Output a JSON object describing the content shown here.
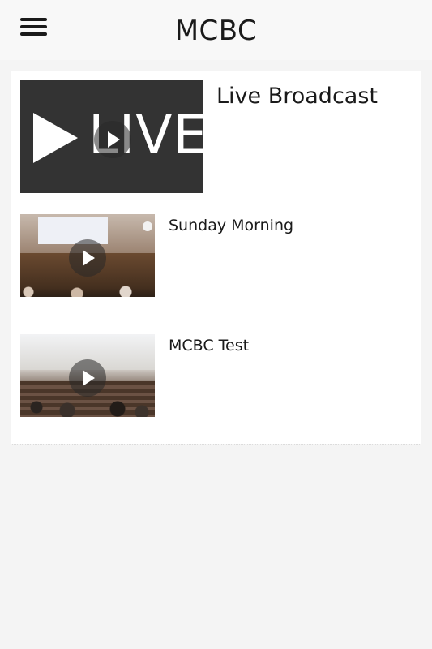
{
  "header": {
    "title": "MCBC",
    "menu_icon": "hamburger-menu-icon"
  },
  "videos": [
    {
      "title": "Live Broadcast",
      "thumbnail_text": "LIVE",
      "thumbnail_style": "live-banner"
    },
    {
      "title": "Sunday Morning",
      "thumbnail_style": "sanctuary-photo"
    },
    {
      "title": "MCBC Test",
      "thumbnail_style": "sanctuary-photo"
    }
  ],
  "colors": {
    "header_background": "#f8f8f8",
    "page_background": "#f4f4f4",
    "card_background": "#ffffff",
    "live_thumbnail_background": "#333333",
    "text": "#1a1a1a"
  }
}
